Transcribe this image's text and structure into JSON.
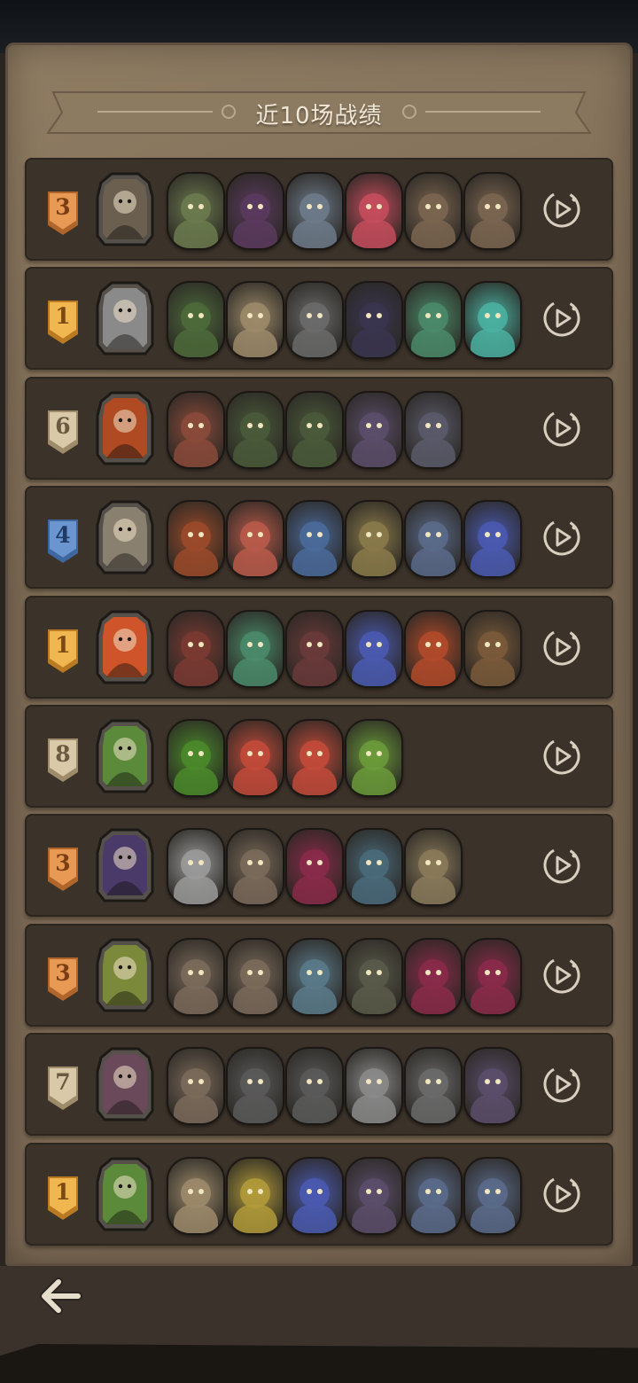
{
  "title": "近10场战绩",
  "rank_colors": {
    "1": {
      "fill": "#f0b650",
      "dark": "#b97a22",
      "text": "#7a4a10"
    },
    "3": {
      "fill": "#e89a55",
      "dark": "#b0652a",
      "text": "#7a3e12"
    },
    "4": {
      "fill": "#6a95cf",
      "dark": "#3f679f",
      "text": "#1f3b66"
    },
    "6": {
      "fill": "#d9c9a9",
      "dark": "#9d8b6a",
      "text": "#6a5a40"
    },
    "7": {
      "fill": "#d9c9a9",
      "dark": "#9d8b6a",
      "text": "#6a5a40"
    },
    "8": {
      "fill": "#d9c9a9",
      "dark": "#9d8b6a",
      "text": "#6a5a40"
    }
  },
  "matches": [
    {
      "rank": "3",
      "hero": {
        "icon": "gunslinger-portrait",
        "color": "#6b6050"
      },
      "units": [
        {
          "icon": "stone-golem-icon",
          "color": "#6b7a4e"
        },
        {
          "icon": "witch-doctor-icon",
          "color": "#5a3a5e"
        },
        {
          "icon": "hippo-brute-icon",
          "color": "#6d7a8a"
        },
        {
          "icon": "flamingo-icon",
          "color": "#c44c5c"
        },
        {
          "icon": "bear-pirate-icon",
          "color": "#7a6550"
        },
        {
          "icon": "bear-pirate-icon",
          "color": "#7a6550"
        }
      ]
    },
    {
      "rank": "1",
      "hero": {
        "icon": "old-wizard-portrait",
        "color": "#8a8a8a"
      },
      "units": [
        {
          "icon": "bat-dragon-icon",
          "color": "#4c6a3a"
        },
        {
          "icon": "bone-beast-icon",
          "color": "#9c8a6a"
        },
        {
          "icon": "horned-shaman-icon",
          "color": "#6a6a6a"
        },
        {
          "icon": "dark-mage-icon",
          "color": "#3a3550"
        },
        {
          "icon": "goblin-priest-icon",
          "color": "#4a8a6a"
        },
        {
          "icon": "ghost-lady-icon",
          "color": "#4ab0a0"
        }
      ]
    },
    {
      "rank": "6",
      "hero": {
        "icon": "fire-demon-portrait",
        "color": "#b04a22"
      },
      "units": [
        {
          "icon": "fire-ogre-icon",
          "color": "#8a4a3a"
        },
        {
          "icon": "grinning-demon-icon",
          "color": "#4a5a3a"
        },
        {
          "icon": "hooded-lich-icon",
          "color": "#4a5a3a"
        },
        {
          "icon": "rat-rogue-icon",
          "color": "#5a4e6a"
        },
        {
          "icon": "octopus-knight-icon",
          "color": "#5a5a6a"
        }
      ]
    },
    {
      "rank": "4",
      "hero": {
        "icon": "skeleton-king-portrait",
        "color": "#8a8070"
      },
      "units": [
        {
          "icon": "red-dragon-icon",
          "color": "#9a4a2a"
        },
        {
          "icon": "red-hair-girl-icon",
          "color": "#b85a4a"
        },
        {
          "icon": "blue-lizard-icon",
          "color": "#4a6a9a"
        },
        {
          "icon": "barbarian-icon",
          "color": "#8a7a4a"
        },
        {
          "icon": "dwarf-king-icon",
          "color": "#5a6a8a"
        },
        {
          "icon": "blue-sorceress-icon",
          "color": "#4a5ab0"
        }
      ]
    },
    {
      "rank": "1",
      "hero": {
        "icon": "flame-elemental-portrait",
        "color": "#d0542a"
      },
      "units": [
        {
          "icon": "assassin-icon",
          "color": "#7a3a32"
        },
        {
          "icon": "goblin-priest-icon",
          "color": "#4a8a6a"
        },
        {
          "icon": "harlequin-icon",
          "color": "#6a3a3a"
        },
        {
          "icon": "blue-sorceress-icon",
          "color": "#4a5ab0"
        },
        {
          "icon": "fire-mage-icon",
          "color": "#b04a2a"
        },
        {
          "icon": "cowboy-icon",
          "color": "#7a5a3a"
        }
      ]
    },
    {
      "rank": "8",
      "hero": {
        "icon": "frog-king-portrait",
        "color": "#5a8a3a"
      },
      "units": [
        {
          "icon": "toxic-dragon-icon",
          "color": "#4a8a2a"
        },
        {
          "icon": "grinning-imp-icon",
          "color": "#c24a3a"
        },
        {
          "icon": "grinning-imp-icon",
          "color": "#c24a3a"
        },
        {
          "icon": "sprout-kid-icon",
          "color": "#6a9a3a"
        }
      ]
    },
    {
      "rank": "3",
      "hero": {
        "icon": "vampire-lord-portrait",
        "color": "#4a3a6a"
      },
      "units": [
        {
          "icon": "mad-scientist-icon",
          "color": "#9a9a9a"
        },
        {
          "icon": "rocket-barrage-icon",
          "color": "#7a6a5a"
        },
        {
          "icon": "jester-icon",
          "color": "#8a2a4a"
        },
        {
          "icon": "pirate-ship-icon",
          "color": "#4a6a7a"
        },
        {
          "icon": "clock-golem-icon",
          "color": "#8a7a5a"
        }
      ]
    },
    {
      "rank": "3",
      "hero": {
        "icon": "moss-beast-portrait",
        "color": "#7a8a3a"
      },
      "units": [
        {
          "icon": "rocket-barrage-icon",
          "color": "#7a6a5a"
        },
        {
          "icon": "rocket-barrage-icon",
          "color": "#7a6a5a"
        },
        {
          "icon": "robot-icon",
          "color": "#5a7a8a"
        },
        {
          "icon": "witch-icon",
          "color": "#5a5a4a"
        },
        {
          "icon": "jester-icon",
          "color": "#8a2a4a"
        },
        {
          "icon": "jester-icon",
          "color": "#8a2a4a"
        }
      ]
    },
    {
      "rank": "7",
      "hero": {
        "icon": "gnome-tinker-portrait",
        "color": "#6a4a5a"
      },
      "units": [
        {
          "icon": "rocket-barrage-icon",
          "color": "#7a6a5a"
        },
        {
          "icon": "steam-tank-icon",
          "color": "#5a5a5a"
        },
        {
          "icon": "steam-tank-icon",
          "color": "#5a5a5a"
        },
        {
          "icon": "cannon-icon",
          "color": "#8a8a8a"
        },
        {
          "icon": "diving-bell-icon",
          "color": "#6a6a6a"
        },
        {
          "icon": "rat-rogue-icon",
          "color": "#5a4e6a"
        }
      ]
    },
    {
      "rank": "1",
      "hero": {
        "icon": "frog-king-portrait",
        "color": "#5a8a3a"
      },
      "units": [
        {
          "icon": "bone-beast-icon",
          "color": "#9c8a6a"
        },
        {
          "icon": "star-boy-icon",
          "color": "#b09a3a"
        },
        {
          "icon": "blue-sorceress-icon",
          "color": "#4a5ab0"
        },
        {
          "icon": "rat-rogue-icon",
          "color": "#5a4e6a"
        },
        {
          "icon": "dwarf-king-icon",
          "color": "#5a6a8a"
        },
        {
          "icon": "dwarf-king-icon",
          "color": "#5a6a8a"
        }
      ]
    }
  ]
}
